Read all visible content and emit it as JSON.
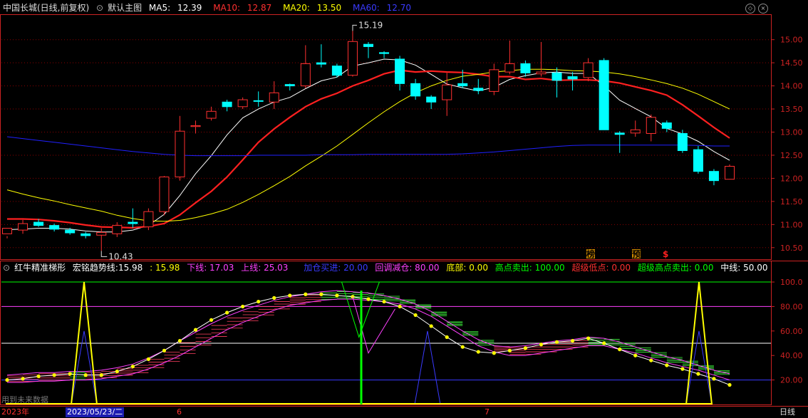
{
  "main_header": {
    "stock": "中国长城(日线,前复权)",
    "template": "默认主图",
    "ma5_label": "MA5:",
    "ma5_value": "12.39",
    "ma10_label": "MA10:",
    "ma10_value": "12.87",
    "ma20_label": "MA20:",
    "ma20_value": "13.50",
    "ma60_label": "MA60:",
    "ma60_value": "12.70"
  },
  "indicator_header": {
    "name": "红牛精准梯形",
    "trend_label": "宏铭趋势线:",
    "trend_value1": "15.98",
    "trend_value2": ": 15.98",
    "lower": "下线: 17.03",
    "upper": "上线: 25.03",
    "add_pos": "加仓买进: 20.00",
    "pullback": "回调减仓: 80.00",
    "bottom": "底部: 0.00",
    "high_sell": "高点卖出: 100.00",
    "super_low": "超级低点: 0.00",
    "super_high_sell": "超级高点卖出: 0.00",
    "mid": "中线: 50.00"
  },
  "footer": {
    "year": "2023年",
    "date": "2023/05/23/二",
    "month1": "6",
    "month2": "7",
    "period": "日线",
    "future_note": "用到未来数据"
  },
  "colors": {
    "up": "#ff3030",
    "down": "#00ffff",
    "ma5": "#ffffff",
    "ma10": "#ff2020",
    "ma20": "#ffff00",
    "ma60": "#2020ff",
    "grid": "#8b0000",
    "axis": "#cc2222"
  },
  "chart_data": [
    {
      "type": "candlestick",
      "title": "中国长城(日线,前复权)",
      "y_ticks": [
        "15.00",
        "14.50",
        "14.00",
        "13.50",
        "13.00",
        "12.50",
        "12.00",
        "11.50",
        "11.00",
        "10.50"
      ],
      "ylim": [
        10.25,
        15.55
      ],
      "annotations": {
        "high": "15.19",
        "low": "10.43"
      },
      "markers": [
        "榜",
        "预",
        "$"
      ],
      "ohlc": [
        [
          10.8,
          10.92,
          10.75,
          10.7
        ],
        [
          10.88,
          11.02,
          11.1,
          10.8
        ],
        [
          11.05,
          10.98,
          11.12,
          10.95
        ],
        [
          10.98,
          10.9,
          11.02,
          10.85
        ],
        [
          10.88,
          10.82,
          10.93,
          10.78
        ],
        [
          10.8,
          10.76,
          10.84,
          10.7
        ],
        [
          10.77,
          10.83,
          10.92,
          10.43
        ],
        [
          10.8,
          10.98,
          11.05,
          10.73
        ],
        [
          11.05,
          11.02,
          11.35,
          10.93
        ],
        [
          10.95,
          11.28,
          11.35,
          10.88
        ],
        [
          11.28,
          12.03,
          12.05,
          11.2
        ],
        [
          12.03,
          13.02,
          13.35,
          11.95
        ],
        [
          13.12,
          13.14,
          13.25,
          12.97
        ],
        [
          13.3,
          13.45,
          13.55,
          13.25
        ],
        [
          13.65,
          13.55,
          13.7,
          13.45
        ],
        [
          13.55,
          13.7,
          13.75,
          13.5
        ],
        [
          13.68,
          13.67,
          13.88,
          13.55
        ],
        [
          13.65,
          13.85,
          14.1,
          13.5
        ],
        [
          14.03,
          14.0,
          14.05,
          13.9
        ],
        [
          14.0,
          14.48,
          14.88,
          13.95
        ],
        [
          14.5,
          14.47,
          14.9,
          14.4
        ],
        [
          14.43,
          14.23,
          14.48,
          14.18
        ],
        [
          14.23,
          14.96,
          15.19,
          14.2
        ],
        [
          14.9,
          14.85,
          14.95,
          14.6
        ],
        [
          14.72,
          14.7,
          14.75,
          14.6
        ],
        [
          14.58,
          14.05,
          14.65,
          13.9
        ],
        [
          14.05,
          13.78,
          14.15,
          13.7
        ],
        [
          13.76,
          13.65,
          13.8,
          13.5
        ],
        [
          13.7,
          14.02,
          14.28,
          13.35
        ],
        [
          14.05,
          14.0,
          14.35,
          13.95
        ],
        [
          13.95,
          13.9,
          14.15,
          13.82
        ],
        [
          13.88,
          14.35,
          14.48,
          13.8
        ],
        [
          14.3,
          14.48,
          14.98,
          14.25
        ],
        [
          14.48,
          14.28,
          14.55,
          14.2
        ],
        [
          14.26,
          14.3,
          14.95,
          14.2
        ],
        [
          14.28,
          14.12,
          14.4,
          13.75
        ],
        [
          14.2,
          14.15,
          14.3,
          13.9
        ],
        [
          14.18,
          14.5,
          14.6,
          14.1
        ],
        [
          14.55,
          13.05,
          14.6,
          13.05
        ],
        [
          12.98,
          12.95,
          13.02,
          12.55
        ],
        [
          12.98,
          13.05,
          13.25,
          12.9
        ],
        [
          12.97,
          13.32,
          13.38,
          12.8
        ],
        [
          13.2,
          13.08,
          13.25,
          13.0
        ],
        [
          12.97,
          12.6,
          13.05,
          12.55
        ],
        [
          12.62,
          12.15,
          12.7,
          12.1
        ],
        [
          12.15,
          11.95,
          12.2,
          11.85
        ],
        [
          11.98,
          12.26,
          12.3,
          11.98
        ]
      ],
      "series": [
        {
          "name": "MA5",
          "values": [
            10.89,
            10.9,
            10.92,
            10.92,
            10.9,
            10.86,
            10.84,
            10.84,
            10.88,
            10.98,
            11.22,
            11.63,
            12.1,
            12.49,
            12.94,
            13.31,
            13.5,
            13.65,
            13.75,
            13.94,
            14.11,
            14.19,
            14.43,
            14.5,
            14.58,
            14.56,
            14.45,
            14.25,
            14.04,
            13.96,
            13.89,
            13.97,
            14.14,
            14.22,
            14.28,
            14.3,
            14.27,
            14.27,
            14.0,
            13.69,
            13.51,
            13.33,
            13.08,
            12.96,
            12.8,
            12.58,
            12.39
          ]
        },
        {
          "name": "MA10",
          "values": [
            11.12,
            11.12,
            11.11,
            11.08,
            11.04,
            10.99,
            10.95,
            10.94,
            10.93,
            10.96,
            11.02,
            11.21,
            11.47,
            11.72,
            12.03,
            12.4,
            12.78,
            13.07,
            13.32,
            13.55,
            13.72,
            13.84,
            14.0,
            14.12,
            14.26,
            14.34,
            14.3,
            14.32,
            14.3,
            14.29,
            14.25,
            14.2,
            14.2,
            14.14,
            14.16,
            14.12,
            14.13,
            14.13,
            14.11,
            14.06,
            13.98,
            13.9,
            13.8,
            13.59,
            13.35,
            13.1,
            12.87
          ]
        },
        {
          "name": "MA20",
          "values": [
            11.75,
            11.66,
            11.58,
            11.51,
            11.43,
            11.36,
            11.29,
            11.2,
            11.13,
            11.08,
            11.07,
            11.09,
            11.15,
            11.23,
            11.33,
            11.48,
            11.65,
            11.84,
            12.04,
            12.27,
            12.48,
            12.7,
            12.95,
            13.2,
            13.44,
            13.66,
            13.85,
            14.0,
            14.12,
            14.21,
            14.25,
            14.3,
            14.33,
            14.36,
            14.36,
            14.35,
            14.33,
            14.32,
            14.3,
            14.26,
            14.2,
            14.13,
            14.05,
            13.95,
            13.82,
            13.66,
            13.5
          ]
        },
        {
          "name": "MA60",
          "values": [
            12.9,
            12.86,
            12.82,
            12.78,
            12.74,
            12.7,
            12.66,
            12.62,
            12.58,
            12.55,
            12.52,
            12.5,
            12.49,
            12.49,
            12.49,
            12.49,
            12.5,
            12.5,
            12.5,
            12.5,
            12.51,
            12.51,
            12.51,
            12.52,
            12.52,
            12.52,
            12.52,
            12.52,
            12.52,
            12.53,
            12.55,
            12.57,
            12.6,
            12.63,
            12.66,
            12.69,
            12.71,
            12.72,
            12.72,
            12.72,
            12.72,
            12.72,
            12.72,
            12.72,
            12.71,
            12.7,
            12.7
          ]
        }
      ]
    },
    {
      "type": "line",
      "title": "红牛精准梯形",
      "y_ticks": [
        "100.0",
        "80.00",
        "60.00",
        "40.00",
        "20.00"
      ],
      "ylim": [
        0,
        107
      ],
      "series": [
        {
          "name": "宏铭趋势线",
          "values": [
            20,
            21,
            23,
            24,
            25,
            24,
            24,
            27,
            31,
            37,
            44,
            52,
            61,
            69,
            75,
            80,
            84,
            87,
            89,
            90,
            90,
            89,
            88,
            86,
            84,
            80,
            73,
            64,
            55,
            47,
            43,
            42,
            44,
            46,
            49,
            51,
            52,
            54,
            50,
            45,
            40,
            36,
            32,
            29,
            25,
            21,
            16
          ]
        },
        {
          "name": "下线",
          "values": [
            18,
            18,
            19,
            19,
            20,
            20,
            21,
            23,
            25,
            29,
            34,
            40,
            47,
            54,
            61,
            67,
            72,
            77,
            81,
            83,
            85,
            86,
            86,
            85,
            84,
            82,
            78,
            72,
            64,
            56,
            48,
            43,
            40,
            40,
            42,
            44,
            46,
            48,
            48,
            45,
            42,
            38,
            34,
            31,
            28,
            24,
            20
          ]
        },
        {
          "name": "上线",
          "values": [
            24,
            25,
            26,
            26,
            27,
            27,
            28,
            30,
            33,
            38,
            44,
            52,
            59,
            66,
            72,
            77,
            81,
            85,
            88,
            90,
            92,
            93,
            92,
            91,
            89,
            86,
            82,
            76,
            68,
            60,
            53,
            48,
            47,
            48,
            50,
            52,
            53,
            55,
            54,
            51,
            47,
            43,
            39,
            36,
            32,
            28,
            25
          ]
        },
        {
          "name": "加仓买进",
          "values": [
            20,
            20,
            20,
            20,
            20,
            20,
            20,
            20,
            20,
            20,
            20,
            20,
            20,
            20,
            20,
            20,
            20,
            20,
            20,
            20,
            20,
            20,
            20,
            20,
            20,
            20,
            20,
            20,
            20,
            20,
            20,
            20,
            20,
            20,
            20,
            20,
            20,
            20,
            20,
            20,
            20,
            20,
            20,
            20,
            20,
            20,
            20
          ]
        },
        {
          "name": "回调减仓",
          "values": [
            80,
            80,
            80,
            80,
            80,
            80,
            80,
            80,
            80,
            80,
            80,
            80,
            80,
            80,
            80,
            80,
            80,
            80,
            80,
            80,
            80,
            80,
            80,
            80,
            80,
            80,
            80,
            80,
            80,
            80,
            80,
            80,
            80,
            80,
            80,
            80,
            80,
            80,
            80,
            80,
            80,
            80,
            80,
            80,
            80,
            80,
            80
          ]
        },
        {
          "name": "中线",
          "values": [
            50,
            50,
            50,
            50,
            50,
            50,
            50,
            50,
            50,
            50,
            50,
            50,
            50,
            50,
            50,
            50,
            50,
            50,
            50,
            50,
            50,
            50,
            50,
            50,
            50,
            50,
            50,
            50,
            50,
            50,
            50,
            50,
            50,
            50,
            50,
            50,
            50,
            50,
            50,
            50,
            50,
            50,
            50,
            50,
            50,
            50,
            50
          ]
        },
        {
          "name": "高点卖出",
          "values": [
            100,
            100,
            100,
            100,
            100,
            100,
            100,
            100,
            100,
            100,
            100,
            100,
            100,
            100,
            100,
            100,
            100,
            100,
            100,
            100,
            100,
            100,
            100,
            100,
            100,
            100,
            100,
            100,
            100,
            100,
            100,
            100,
            100,
            100,
            100,
            100,
            100,
            100,
            100,
            100,
            100,
            100,
            100,
            100,
            100,
            100,
            100
          ]
        }
      ]
    }
  ]
}
